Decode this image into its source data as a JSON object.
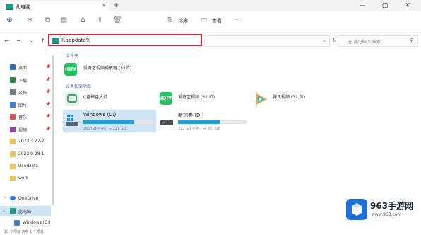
{
  "titlebar": {
    "tab_title": "此电脑",
    "new_tab": "+",
    "min": "—",
    "max": "▢",
    "close": "✕"
  },
  "toolbar": {
    "sort_label": "排序",
    "view_label": "查看",
    "more": "···"
  },
  "address": {
    "path": "%appdata%",
    "search_placeholder": "在 此电脑 中搜索"
  },
  "sidebar": {
    "items": [
      {
        "label": "桌面",
        "color": "#2b6cc4"
      },
      {
        "label": "下载",
        "color": "#2b8a3e"
      },
      {
        "label": "文档",
        "color": "#6b7d93"
      },
      {
        "label": "图片",
        "color": "#3b7dd8"
      },
      {
        "label": "音乐",
        "color": "#d9534f"
      },
      {
        "label": "视频",
        "color": "#8e44ad"
      },
      {
        "label": "2023.3.27-2",
        "color": "#e9c45a"
      },
      {
        "label": "2023.9.28-1",
        "color": "#e9c45a"
      },
      {
        "label": "UserData",
        "color": "#e9c45a"
      },
      {
        "label": "work",
        "color": "#e9c45a"
      }
    ],
    "onedrive": "OneDrive",
    "this_pc": "此电脑",
    "windows_c": "Windows (C:)"
  },
  "content": {
    "frequent_header": "文件夹",
    "frequent_item": "爱奇艺视频播放器 (32位)",
    "devices_header": "设备和驱动器",
    "devices": [
      {
        "label": "C盘磁盘大师"
      },
      {
        "label": "爱奇艺视频 (32 位)"
      },
      {
        "label": "腾讯视频 (32 位)"
      }
    ],
    "drives": [
      {
        "label": "Windows (C:)",
        "detail": "161 GB 可用，共 221 GB",
        "used": 0.73
      },
      {
        "label": "新加卷 (D:)",
        "detail": "372 GB 可用，共 931 GB",
        "used": 0.6
      }
    ]
  },
  "statusbar": {
    "text": "10 个项目   选中 1 个项目"
  },
  "watermark": {
    "brand": "963手游网",
    "url": "www.963.com"
  },
  "colors": {
    "accent": "#c62d3b",
    "iqiyi": "#25c260",
    "drive_fill": "#26a0da"
  }
}
